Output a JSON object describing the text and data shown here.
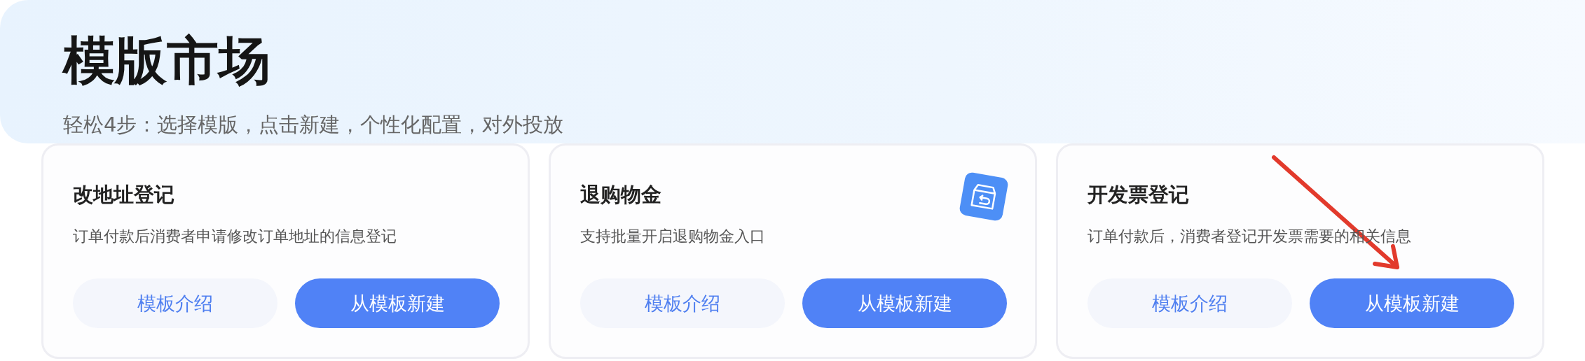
{
  "header": {
    "title": "模版市场",
    "subtitle": "轻松4步：选择模版，点击新建，个性化配置，对外投放"
  },
  "templates": [
    {
      "title": "改地址登记",
      "description": "订单付款后消费者申请修改订单地址的信息登记",
      "badge_icon": false,
      "intro_button": "模板介绍",
      "create_button": "从模板新建"
    },
    {
      "title": "退购物金",
      "description": "支持批量开启退购物金入口",
      "badge_icon": true,
      "intro_button": "模板介绍",
      "create_button": "从模板新建"
    },
    {
      "title": "开发票登记",
      "description": "订单付款后，消费者登记开发票需要的相关信息",
      "badge_icon": false,
      "intro_button": "模板介绍",
      "create_button": "从模板新建"
    }
  ]
}
